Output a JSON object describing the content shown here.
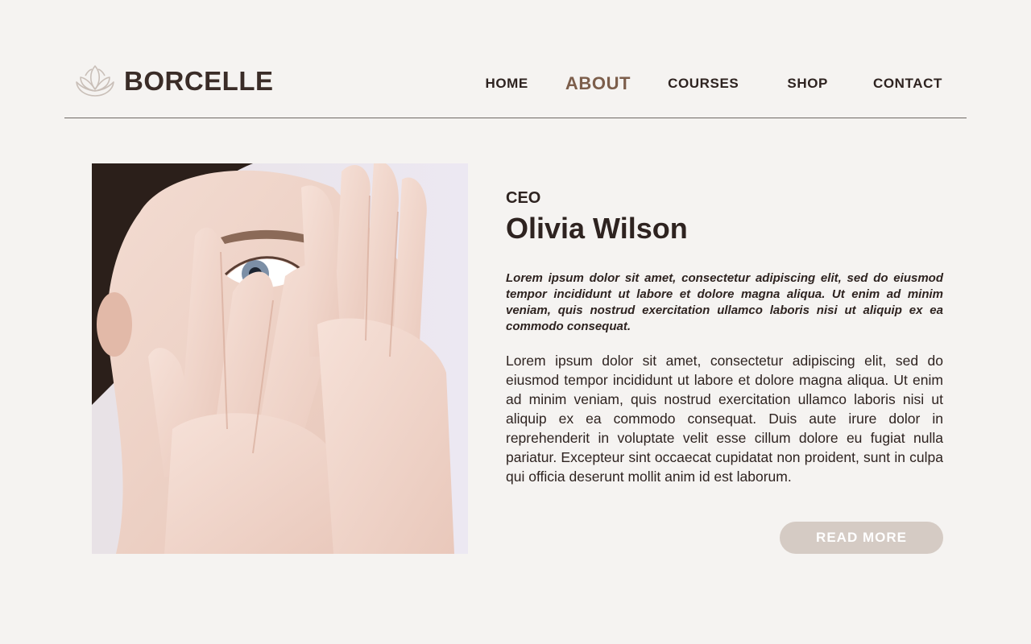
{
  "brand": {
    "name": "BORCELLE",
    "logo_icon": "lotus-icon",
    "logo_color": "#c9bfb8"
  },
  "nav": {
    "items": [
      {
        "label": "HOME",
        "active": false
      },
      {
        "label": "ABOUT",
        "active": true
      },
      {
        "label": "COURSES",
        "active": false
      },
      {
        "label": "SHOP",
        "active": false
      },
      {
        "label": "CONTACT",
        "active": false
      }
    ],
    "active_color": "#7c5e4b"
  },
  "profile": {
    "role": "CEO",
    "name": "Olivia Wilson",
    "lead": "Lorem ipsum dolor sit amet, consectetur adipiscing elit, sed do eiusmod tempor incididunt ut labore et dolore magna aliqua. Ut enim ad minim veniam, quis nostrud exercitation ullamco laboris nisi ut aliquip ex ea commodo consequat.",
    "body": "Lorem ipsum dolor sit amet, consectetur adipiscing elit, sed do eiusmod tempor incididunt ut labore et dolore magna aliqua. Ut enim ad minim veniam, quis nostrud exercitation ullamco laboris nisi ut aliquip ex ea commodo consequat. Duis aute irure dolor in reprehenderit in voluptate velit esse cillum dolore eu fugiat nulla pariatur. Excepteur sint occaecat cupidatat non proident, sunt in culpa qui officia deserunt mollit anim id est laborum."
  },
  "cta": {
    "label": "READ MORE",
    "color": "#d5cbc4"
  },
  "colors": {
    "background": "#f5f3f1",
    "text": "#2e2320"
  }
}
